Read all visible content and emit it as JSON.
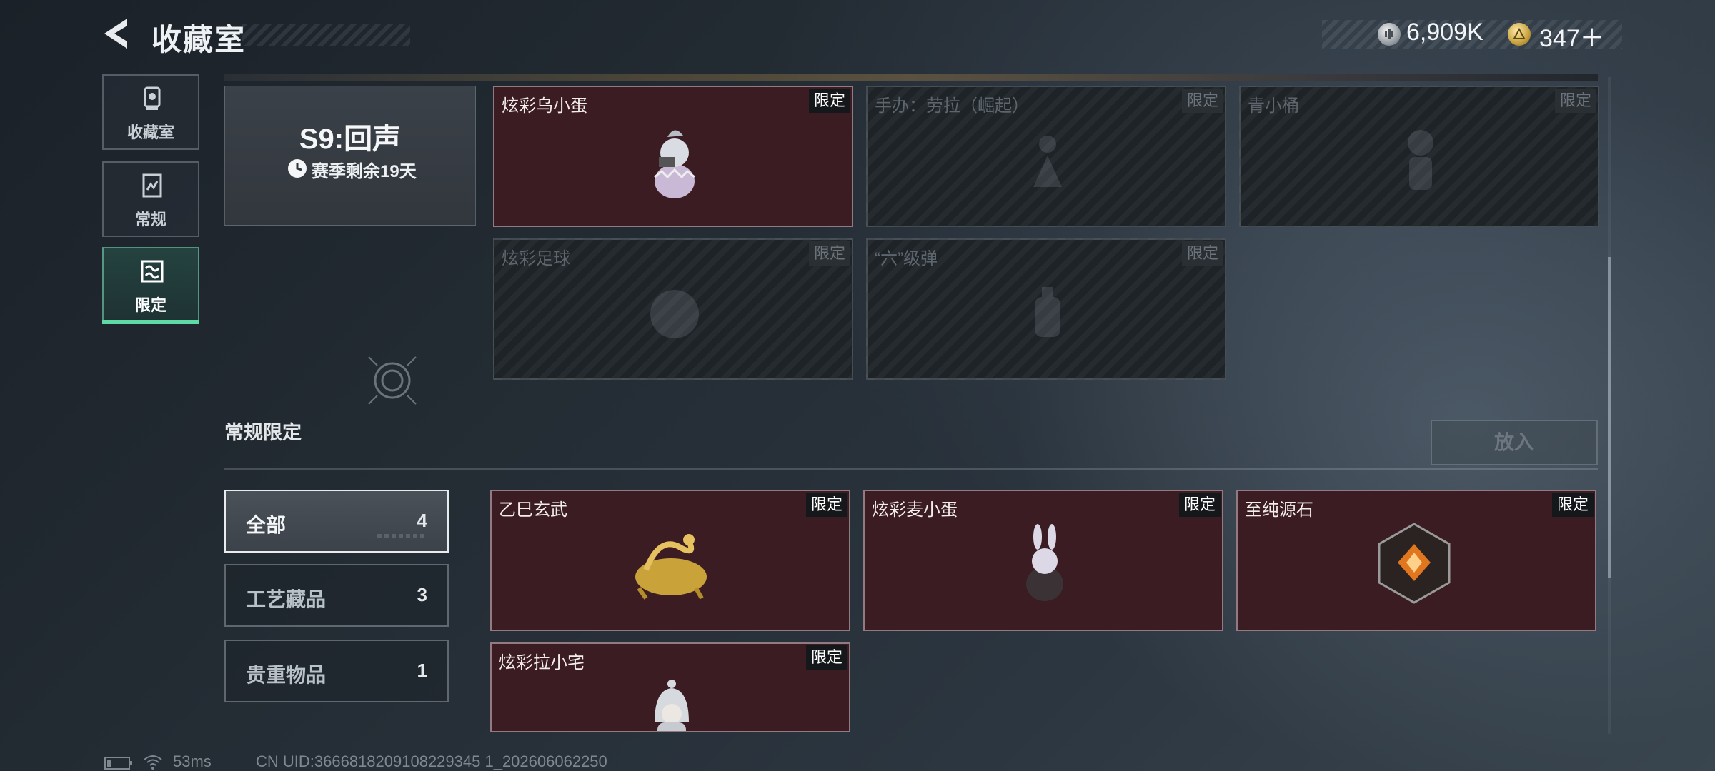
{
  "header": {
    "title": "收藏室",
    "currency": [
      {
        "icon": "silver-coin-icon",
        "value": "6,909K"
      },
      {
        "icon": "gold-coin-icon",
        "value": "347＋"
      }
    ]
  },
  "nav": {
    "items": [
      {
        "label": "收藏室",
        "icon": "trophy-icon",
        "active": false
      },
      {
        "label": "常规",
        "icon": "document-icon",
        "active": false
      },
      {
        "label": "限定",
        "icon": "limited-icon",
        "active": true
      }
    ]
  },
  "season": {
    "title": "S9:回声",
    "remaining": "赛季剩余19天"
  },
  "season_items": [
    {
      "name": "炫彩乌小蛋",
      "badge": "限定",
      "owned": true
    },
    {
      "name": "手办：劳拉（崛起）",
      "badge": "限定",
      "owned": false
    },
    {
      "name": "青小桶",
      "badge": "限定",
      "owned": false
    },
    {
      "name": "炫彩足球",
      "badge": "限定",
      "owned": false
    },
    {
      "name": "“六”级弹",
      "badge": "限定",
      "owned": false
    }
  ],
  "regular": {
    "title": "常规限定",
    "put_in_label": "放入",
    "filters": [
      {
        "label": "全部",
        "count": "4",
        "active": true
      },
      {
        "label": "工艺藏品",
        "count": "3",
        "active": false
      },
      {
        "label": "贵重物品",
        "count": "1",
        "active": false
      }
    ],
    "items": [
      {
        "name": "乙巳玄武",
        "badge": "限定",
        "owned": true
      },
      {
        "name": "炫彩麦小蛋",
        "badge": "限定",
        "owned": true
      },
      {
        "name": "至纯源石",
        "badge": "限定",
        "owned": true
      },
      {
        "name": "炫彩拉小宅",
        "badge": "限定",
        "owned": true
      }
    ]
  },
  "footer": {
    "ping": "53ms",
    "uid": "CN UID:3666818209108229345 1_202606062250"
  },
  "colors": {
    "accent": "#5fd9a6",
    "owned_card": "#3a1c22",
    "locked_card": "#1e2328"
  }
}
